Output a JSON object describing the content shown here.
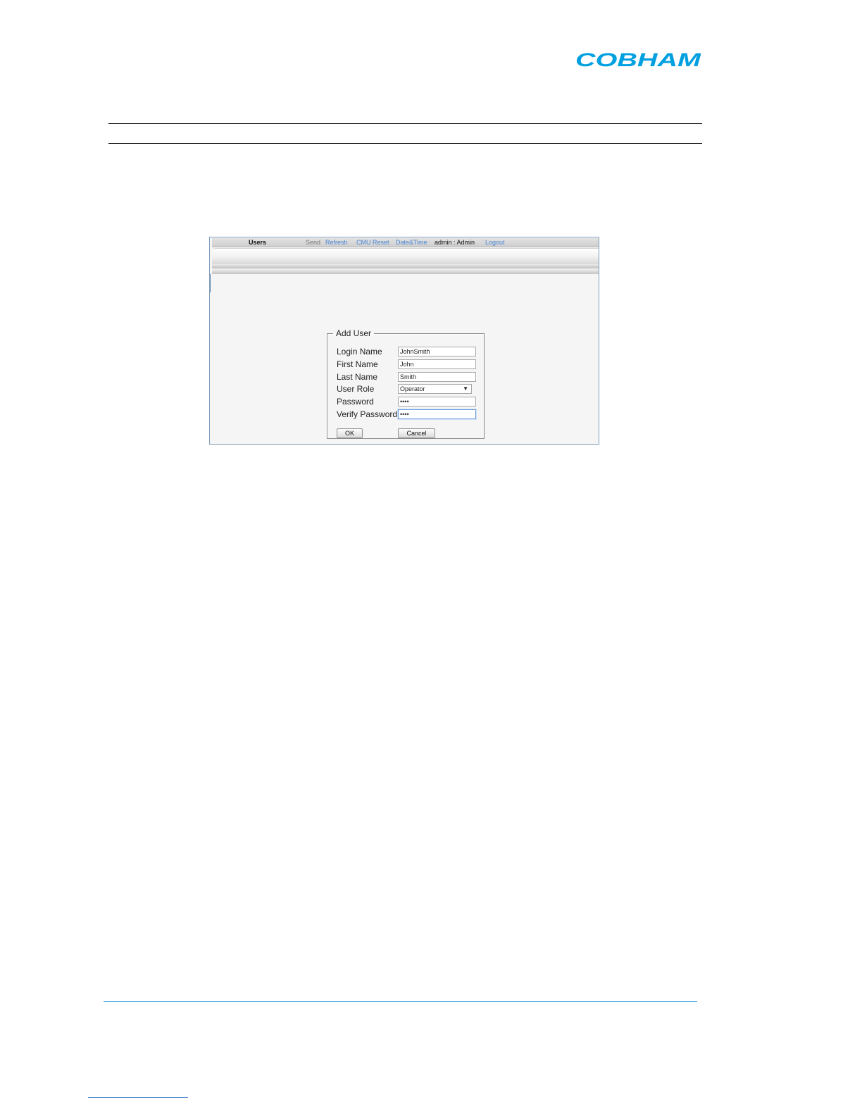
{
  "header": {
    "logo_text": "COBHAM",
    "brand_color": "#00a0e0"
  },
  "app": {
    "toolbar": {
      "section": "Users",
      "send": "Send",
      "refresh": "Refresh",
      "cmu_reset": "CMU Reset",
      "date_time": "Date&Time",
      "user": "admin : Admin",
      "logout": "Logout"
    },
    "dialog": {
      "legend": "Add User",
      "login_name_label": "Login Name",
      "login_name_value": "JohnSmith",
      "first_name_label": "First Name",
      "first_name_value": "John",
      "last_name_label": "Last Name",
      "last_name_value": "Smith",
      "user_role_label": "User Role",
      "user_role_value": "Operator",
      "password_label": "Password",
      "password_value": "••••",
      "verify_password_label": "Verify Password",
      "verify_password_value": "••••",
      "ok_label": "OK",
      "cancel_label": "Cancel"
    }
  }
}
